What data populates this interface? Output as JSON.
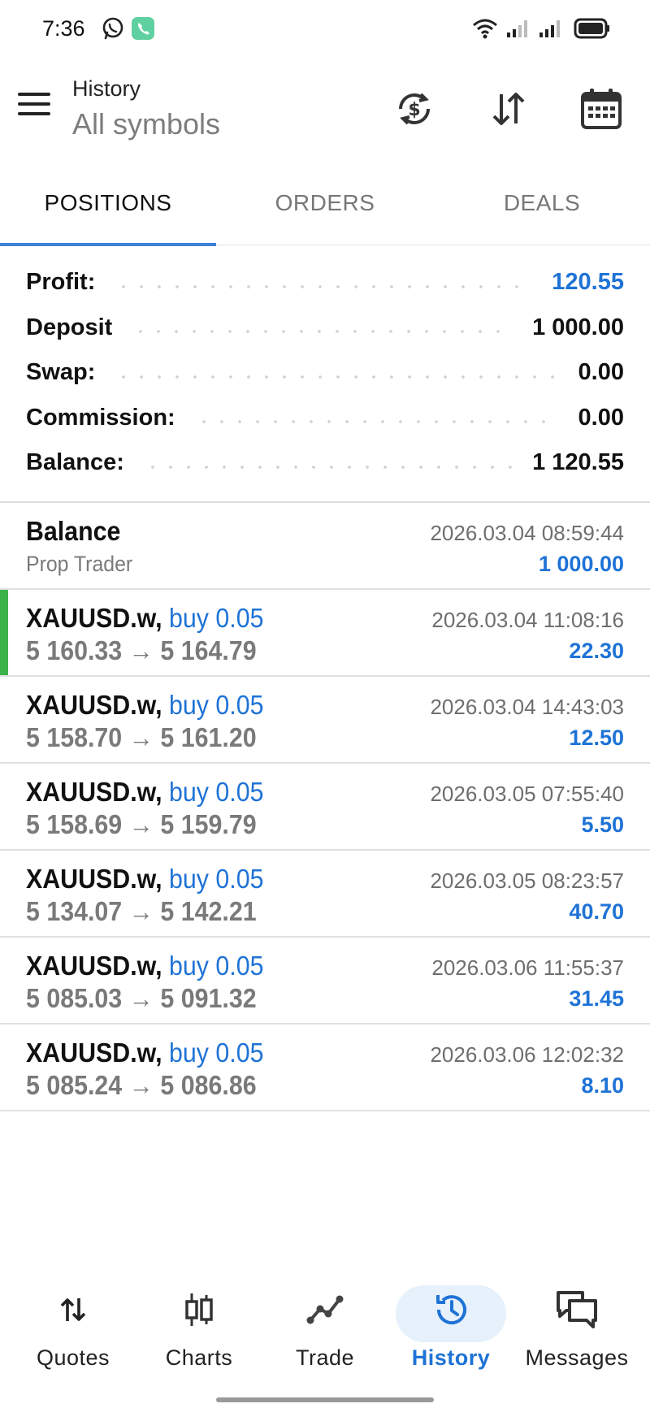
{
  "status_bar": {
    "time": "7:36"
  },
  "header": {
    "title": "History",
    "subtitle": "All symbols",
    "icons": [
      "currency-exchange-icon",
      "sort-icon",
      "calendar-icon"
    ]
  },
  "tabs": [
    {
      "label": "POSITIONS",
      "active": true
    },
    {
      "label": "ORDERS",
      "active": false
    },
    {
      "label": "DEALS",
      "active": false
    }
  ],
  "summary": [
    {
      "label": "Profit:",
      "value": "120.55",
      "highlight": true
    },
    {
      "label": "Deposit",
      "value": "1 000.00",
      "highlight": false
    },
    {
      "label": "Swap:",
      "value": "0.00",
      "highlight": false
    },
    {
      "label": "Commission:",
      "value": "0.00",
      "highlight": false
    },
    {
      "label": "Balance:",
      "value": "1 120.55",
      "highlight": false
    }
  ],
  "history": {
    "balance_entry": {
      "title": "Balance",
      "subtitle": "Prop Trader",
      "time": "2026.03.04 08:59:44",
      "amount": "1 000.00"
    },
    "positions": [
      {
        "symbol": "XAUUSD.w,",
        "side": "buy 0.05",
        "prices": "5 160.33 → 5 164.79",
        "time": "2026.03.04 11:08:16",
        "profit": "22.30",
        "selected": true
      },
      {
        "symbol": "XAUUSD.w,",
        "side": "buy 0.05",
        "prices": "5 158.70 → 5 161.20",
        "time": "2026.03.04 14:43:03",
        "profit": "12.50",
        "selected": false
      },
      {
        "symbol": "XAUUSD.w,",
        "side": "buy 0.05",
        "prices": "5 158.69 → 5 159.79",
        "time": "2026.03.05 07:55:40",
        "profit": "5.50",
        "selected": false
      },
      {
        "symbol": "XAUUSD.w,",
        "side": "buy 0.05",
        "prices": "5 134.07 → 5 142.21",
        "time": "2026.03.05 08:23:57",
        "profit": "40.70",
        "selected": false
      },
      {
        "symbol": "XAUUSD.w,",
        "side": "buy 0.05",
        "prices": "5 085.03 → 5 091.32",
        "time": "2026.03.06 11:55:37",
        "profit": "31.45",
        "selected": false
      },
      {
        "symbol": "XAUUSD.w,",
        "side": "buy 0.05",
        "prices": "5 085.24 → 5 086.86",
        "time": "2026.03.06 12:02:32",
        "profit": "8.10",
        "selected": false
      }
    ]
  },
  "bottom_nav": [
    {
      "label": "Quotes",
      "icon": "quotes-arrows-icon",
      "active": false
    },
    {
      "label": "Charts",
      "icon": "candlestick-icon",
      "active": false
    },
    {
      "label": "Trade",
      "icon": "trade-line-icon",
      "active": false
    },
    {
      "label": "History",
      "icon": "history-clock-icon",
      "active": true
    },
    {
      "label": "Messages",
      "icon": "messages-icon",
      "active": false
    }
  ],
  "colors": {
    "accent": "#1f73d6",
    "selected_bar": "#3bb34a",
    "tab_underline": "#3d82d8",
    "nav_active_bg": "#e6f1fc"
  }
}
